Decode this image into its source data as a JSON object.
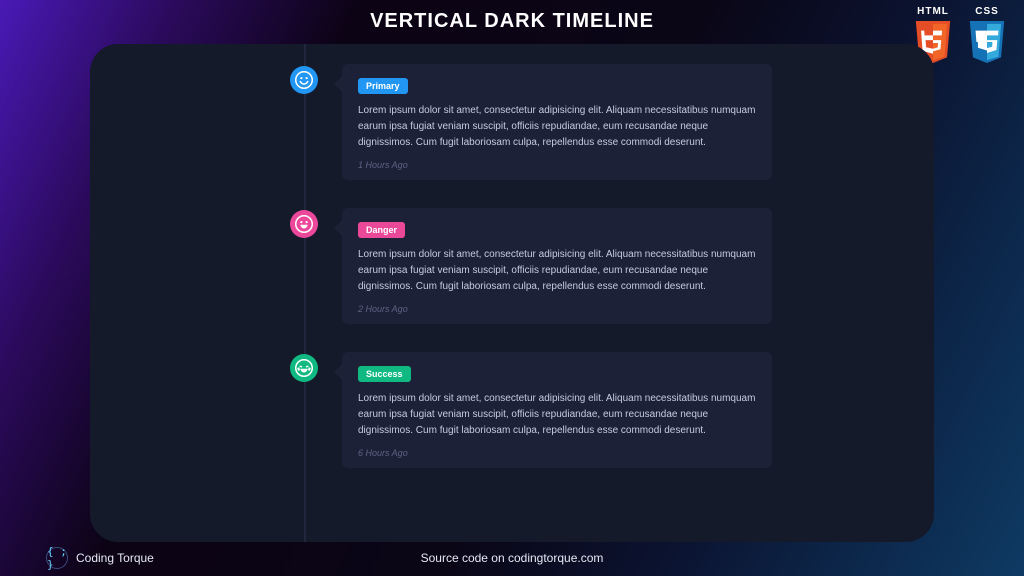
{
  "page_title": "VERTICAL DARK TIMELINE",
  "tech": {
    "html": "HTML",
    "css": "CSS"
  },
  "colors": {
    "primary": "#2196f3",
    "danger": "#ec4899",
    "success": "#10b981",
    "card_bg": "#1c2137",
    "panel_bg": "#151a2b"
  },
  "timeline": {
    "items": [
      {
        "icon": "smile-icon",
        "icon_color": "#2196f3",
        "badge_label": "Primary",
        "badge_color": "#2196f3",
        "body": "Lorem ipsum dolor sit amet, consectetur adipisicing elit. Aliquam necessitatibus numquam earum ipsa fugiat veniam suscipit, officiis repudiandae, eum recusandae neque dignissimos. Cum fugit laboriosam culpa, repellendus esse commodi deserunt.",
        "time": "1 Hours Ago"
      },
      {
        "icon": "grin-icon",
        "icon_color": "#ec4899",
        "badge_label": "Danger",
        "badge_color": "#ec4899",
        "body": "Lorem ipsum dolor sit amet, consectetur adipisicing elit. Aliquam necessitatibus numquam earum ipsa fugiat veniam suscipit, officiis repudiandae, eum recusandae neque dignissimos. Cum fugit laboriosam culpa, repellendus esse commodi deserunt.",
        "time": "2 Hours Ago"
      },
      {
        "icon": "laugh-icon",
        "icon_color": "#10b981",
        "badge_label": "Success",
        "badge_color": "#10b981",
        "body": "Lorem ipsum dolor sit amet, consectetur adipisicing elit. Aliquam necessitatibus numquam earum ipsa fugiat veniam suscipit, officiis repudiandae, eum recusandae neque dignissimos. Cum fugit laboriosam culpa, repellendus esse commodi deserunt.",
        "time": "6 Hours Ago"
      }
    ]
  },
  "footer": {
    "brand": "Coding Torque",
    "brand_glyph": "{ ; }",
    "source": "Source code on codingtorque.com"
  }
}
